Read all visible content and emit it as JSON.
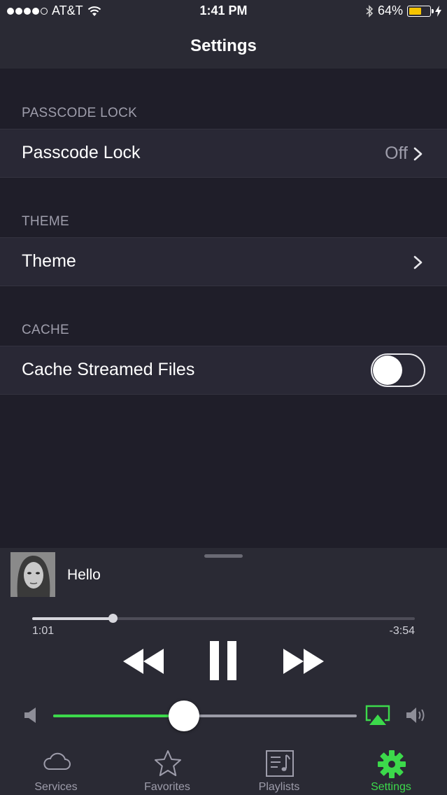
{
  "status_bar": {
    "carrier": "AT&T",
    "time": "1:41 PM",
    "battery_percent": "64%",
    "battery_level": 0.64,
    "icons": [
      "signal-dots",
      "wifi-icon",
      "bluetooth-icon",
      "battery-icon",
      "charging-bolt-icon"
    ]
  },
  "nav": {
    "title": "Settings"
  },
  "sections": [
    {
      "header": "PASSCODE LOCK",
      "cell": {
        "label": "Passcode Lock",
        "value": "Off",
        "accessory": "chevron-right-icon"
      }
    },
    {
      "header": "THEME",
      "cell": {
        "label": "Theme",
        "value": "",
        "accessory": "chevron-right-icon"
      }
    },
    {
      "header": "CACHE",
      "cell": {
        "label": "Cache Streamed Files",
        "toggle": false
      }
    }
  ],
  "player": {
    "track_title": "Hello",
    "elapsed": "1:01",
    "remaining": "-3:54",
    "progress": 0.21,
    "volume": 0.43,
    "accent": "#3cd94b",
    "icons": [
      "rewind-icon",
      "pause-icon",
      "fast-forward-icon",
      "volume-low-icon",
      "airplay-icon",
      "volume-high-icon"
    ]
  },
  "tabs": [
    {
      "label": "Services",
      "icon": "cloud-icon",
      "active": false
    },
    {
      "label": "Favorites",
      "icon": "star-icon",
      "active": false
    },
    {
      "label": "Playlists",
      "icon": "playlist-icon",
      "active": false
    },
    {
      "label": "Settings",
      "icon": "gear-icon",
      "active": true
    }
  ]
}
